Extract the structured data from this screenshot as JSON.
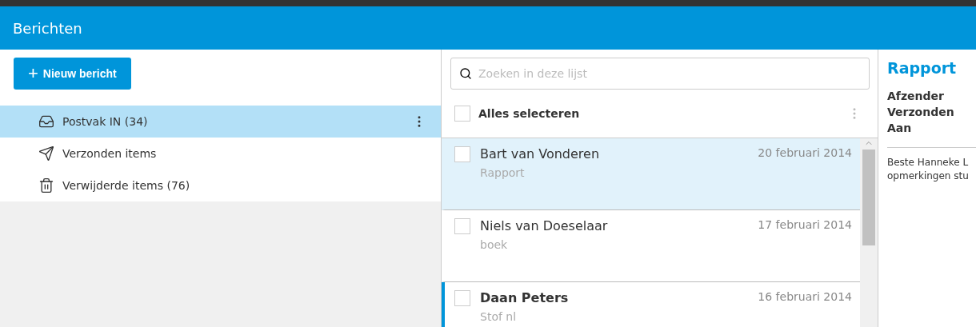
{
  "header": {
    "title": "Berichten"
  },
  "new_button": {
    "icon": "+",
    "label": "Nieuw bericht"
  },
  "folders": [
    {
      "kind": "inbox",
      "label": "Postvak IN (34)",
      "selected": true
    },
    {
      "kind": "sent",
      "label": "Verzonden items",
      "selected": false
    },
    {
      "kind": "trash",
      "label": "Verwijderde items (76)",
      "selected": false
    }
  ],
  "search": {
    "placeholder": "Zoeken in deze lijst"
  },
  "select_all": {
    "label": "Alles selecteren",
    "checked": false
  },
  "messages": [
    {
      "sender": "Bart van Vonderen",
      "subject": "Rapport",
      "date": "20 februari 2014",
      "selected": true,
      "unread": false,
      "checked": false
    },
    {
      "sender": "Niels van Doeselaar",
      "subject": "boek",
      "date": "17 februari 2014",
      "selected": false,
      "unread": false,
      "checked": false
    },
    {
      "sender": "Daan Peters",
      "subject": "Stof nl",
      "date": "16 februari 2014",
      "selected": false,
      "unread": true,
      "checked": false
    }
  ],
  "preview": {
    "title": "Rapport",
    "fields": [
      "Afzender",
      "Verzonden",
      "Aan"
    ],
    "body_lines": [
      "Beste Hanneke L",
      "opmerkingen stu"
    ]
  }
}
